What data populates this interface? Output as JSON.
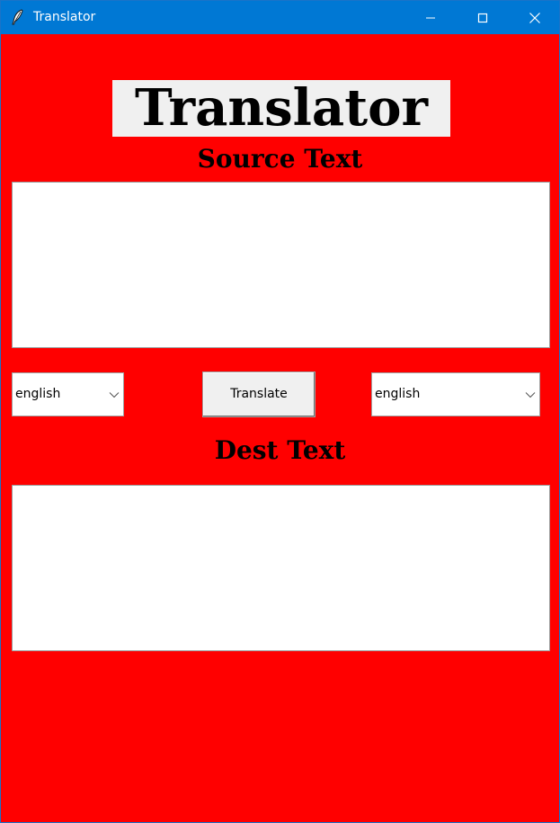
{
  "window": {
    "title": "Translator",
    "icon": "feather-icon",
    "titlebar_color": "#0078d4",
    "controls": [
      "minimize-icon",
      "maximize-icon",
      "close-icon"
    ]
  },
  "app": {
    "background_color": "#ff0000",
    "title": "Translator",
    "source_label": "Source Text",
    "dest_label": "Dest Text",
    "source_text": "",
    "dest_text": ""
  },
  "controls": {
    "source_language": "english",
    "dest_language": "english",
    "translate_label": "Translate",
    "dropdown_icon": "chevron-down-icon"
  }
}
